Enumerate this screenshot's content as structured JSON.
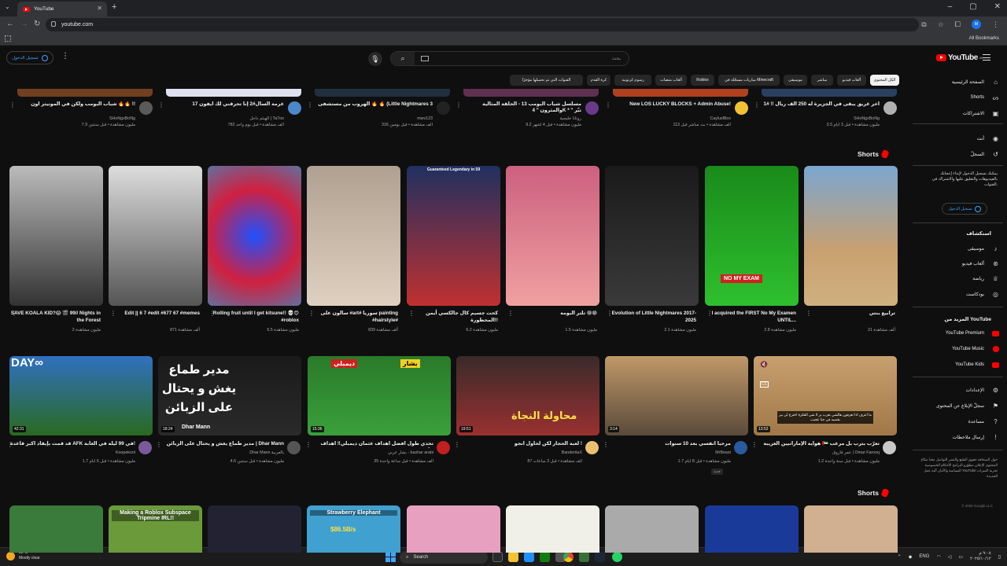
{
  "browser": {
    "tab_title": "YouTube",
    "url": "youtube.com",
    "all_bookmarks": "All Bookmarks"
  },
  "header": {
    "sign_in": "تسجيل الدخول",
    "search_placeholder": "بحث",
    "logo_text": "YouTube",
    "logo_region": "AE"
  },
  "chips": [
    {
      "label": "الكل المحتوى",
      "active": true
    },
    {
      "label": "ألعاب فيديو"
    },
    {
      "label": "مباشر"
    },
    {
      "label": "موسيقى"
    },
    {
      "label": "مباريات مسجّلة في Minecraft"
    },
    {
      "label": "Roblox"
    },
    {
      "label": "ألعاب منصات"
    },
    {
      "label": "رسوم كرتونية"
    },
    {
      "label": "كرة القدم"
    },
    {
      "label": "القنوات التي تم تحميلها مؤخرًا"
    }
  ],
  "sidebar": {
    "home": "الصفحة الرئيسية",
    "shorts": "Shorts",
    "subscriptions": "الاشتراكات",
    "you": "أنت",
    "history": "السجلّ",
    "signin_prompt": "يمكنك تسجيل الدخول لإبداء إعجابك بالفيديوهات والتعليق عليها والاشتراك في القنوات.",
    "signin_button": "تسجيل الدخول",
    "explore_head": "استكشاف",
    "explore": [
      "موسيقى",
      "ألعاب فيديو",
      "رياضة",
      "بودكاست"
    ],
    "more_head": "المزيد من YouTube",
    "more": [
      "YouTube Premium",
      "YouTube Music",
      "YouTube Kids"
    ],
    "settings": [
      "الإعدادات",
      "سجلّ الإبلاغ عن المحتوى",
      "مساعدة",
      "إرسال ملاحظات"
    ],
    "footer": "حول  الصحافة  حقوق الطبع والنشر  التواصل معنا  صنّاع المحتوى  الإعلان  مطوّرو البرامج  الأحكام  الخصوصية  السياسة والأمان  آلية عمل YouTube  تجربة الميزات الجديدة",
    "copyright": "© 2025 Google LLC"
  },
  "row1": [
    {
      "title": "أخر غريق يبقى في الجزيرة له 250 الف ريال !! #1",
      "channel": "SHoNgxBoNg",
      "meta": "3.5 مليون مشاهدة • قبل 3 أيام"
    },
    {
      "title": "New LOS LUCKY BLOCKS + Admin Abuse!",
      "channel": "CaylusBlox",
      "meta": "113 ألف مشاهدة • بث مباشر قبل"
    },
    {
      "title": "مسلسل شباب البومب 13 - الحلقة المثالية والمثرون \" 4K * \" تيّر",
      "channel": "روتانا خليجية",
      "meta": "9.2 مليون مشاهدة • قبل 4 أشهر"
    },
    {
      "title": "الهروب من مستشفى 🔥 🔥 (Little Nightmares 3",
      "channel": "mwv123",
      "meta": "316 ألف مشاهدة • قبل يومين"
    },
    {
      "title": "عرمة السال#2 إنا تحرقني لك ايفون 17",
      "channel": "الهيثم داخل | Ta7oo",
      "meta": "782 ألف مشاهدة • قبل يوم واحد"
    },
    {
      "title": "شباب البومب ولكن في المونيتر اون 🔥🔥 !!",
      "channel": "SHoNgxBoNg",
      "meta": "7.9 مليون مشاهدة • قبل سنتين"
    }
  ],
  "shorts_label": "Shorts",
  "shorts": [
    {
      "title": "ترابيع بنتي",
      "views": "21 ألف مشاهدة"
    },
    {
      "title": "I acquired the FIRST No My Examen UNTIL...",
      "views": "2.8 مليون مشاهدة",
      "thumb_text": "NO MY EXAM"
    },
    {
      "title": "Evolution of Little Nightmares 2017-2025",
      "views": "2.1 مليون مشاهدة"
    },
    {
      "title": "تلتر البومة 😁😁",
      "views": "1.5 مليون مشاهدة"
    },
    {
      "title": "كحت جسيم كال جالكسي أيمن المحظورة!!",
      "views": "6.2 مليون مشاهدة",
      "thumb_text": "Guaranteed Legendary in 59"
    },
    {
      "title": "سالون على #art# سوريا painting #hairstyle#",
      "views": "839 ألف مشاهدة"
    },
    {
      "title": "Rolling fruit until I get kitsune!! 💀😍 #roblox",
      "views": "5.5 مليون مشاهدة"
    },
    {
      "title": "Edit || 6 7 #edit #677 67 #memes",
      "views": "871 ألف مشاهدة"
    },
    {
      "title": "SAVE KOALA KID?😱 🎬 99// Nights in the Forest",
      "views": "2 مليون مشاهدة"
    }
  ],
  "row3": [
    {
      "title": "هواية الإماراتيين الغريبة 🇦🇪 تعرّب بترب بل مرعب",
      "channel": "عمر فاروق | Omar Farooq",
      "meta": "1.2 مليون مشاهدة • قبل سنة واحدة",
      "duration": "13:52",
      "overlay": "ما اعرف اذا تعرفون هالشي بعرب بر لا شي الفكرة اخترع لي ببر بقضيه في جنا عجيب"
    },
    {
      "title": "مرحبا انفسي بعد 10 سنوات",
      "channel": "MrBeast",
      "meta": "1.7 مليون مشاهدة • قبل 8 أيام",
      "duration": "3:14",
      "badge": "جديد"
    },
    {
      "title": "لعبة الحجار لكن لحاول أنجو !",
      "channel": "BanderitaX",
      "meta": "87 ألف مشاهدة • قبل 3 ساعات",
      "duration": "19:51",
      "thumb_text": "محاولة النجاة"
    },
    {
      "title": "تحدي طول أفضل أهداف عثمان ديمبلي‼ أهداف خارقة",
      "channel": "بشار عربي - bashar arabi",
      "meta": "35 ألف مشاهدة • قبل ساعة واحدة",
      "duration": "15:36",
      "thumb_text": "ديمبلي",
      "thumb_text2": "بشار"
    },
    {
      "title": "مدير طماع يغش و يحتال على الزبائن | Dhar Mann",
      "channel": "Dhar Mann بالعربية",
      "meta": "4.6 مليون مشاهدة • قبل سنتين",
      "duration": "18:24",
      "thumb_text": "مدير طماع يغش و يحتال على الزبائن",
      "thumb_tag": "Dhar Mann"
    },
    {
      "title": "قد قمت بإيقاد أكبر قاعدة AFK في 99 ليلة في الغابة!",
      "channel": "Koopekool",
      "meta": "1.7 مليون مشاهدة • قبل 6 أيام",
      "duration": "42:31",
      "thumb_text": "DAY∞"
    }
  ],
  "shorts2_label": "Shorts",
  "shorts2": [
    {
      "thumb_text": ""
    },
    {
      "thumb_text": ""
    },
    {
      "thumb_text": ""
    },
    {
      "thumb_text": ""
    },
    {
      "thumb_text": ""
    },
    {
      "thumb_text": "Strawberry Elephant",
      "thumb_text2": "$86.5B/s"
    },
    {
      "thumb_text": ""
    },
    {
      "thumb_text": "Making a Roblox Subspace Tripmine IRL!!"
    },
    {
      "thumb_text": ""
    }
  ],
  "taskbar": {
    "temp": "32°C",
    "weather": "Mostly clear",
    "search": "Search",
    "lang": "ENG",
    "time": "٩:٠٨ م",
    "date": "٢٠٢٥/١٠/١٢"
  }
}
